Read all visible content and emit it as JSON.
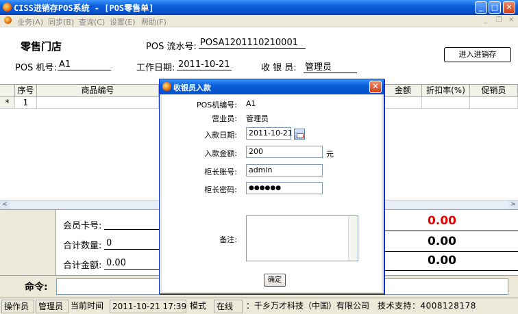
{
  "window": {
    "title": "CISS进销存POS系统 - [POS零售单]",
    "min_label": "_",
    "max_label": "□",
    "close_label": "✕"
  },
  "menu": {
    "items": [
      "业务(A)",
      "同步(B)",
      "查询(C)",
      "设置(E)",
      "帮助(F)"
    ],
    "mdi_controls": [
      "_",
      "❐",
      "✕"
    ]
  },
  "header": {
    "store_name": "零售门店",
    "pos_serial_label": "POS 流水号:",
    "pos_serial_value": "POSA1201110210001",
    "pos_id_label": "POS 机号:",
    "pos_id_value": "A1",
    "work_date_label": "工作日期:",
    "work_date_value": "2011-10-21",
    "cashier_label": "收 银 员:",
    "cashier_value": "管理员",
    "enter_button": "进入进销存"
  },
  "grid": {
    "columns": [
      "序号",
      "商品编号",
      "金额",
      "折扣率(%)",
      "促销员"
    ],
    "row_marker": "*",
    "row_index": "1"
  },
  "scrollbar": {
    "left_arrow": "<",
    "right_arrow": ">"
  },
  "summary": {
    "member_card_label": "会员卡号:",
    "total_qty_label": "合计数量:",
    "total_qty_value": "0",
    "total_amount_label": "合计金额:",
    "total_amount_value": "0.00",
    "right_values": [
      "0.00",
      "0.00",
      "0.00"
    ],
    "right_value_first_color": "#e00000"
  },
  "command": {
    "label": "命令:"
  },
  "status": {
    "operator_label": "操作员",
    "operator_value": "管理员",
    "time_label": "当前时间",
    "time_value": "2011-10-21 17:39",
    "mode_label": "模式",
    "mode_value": "在线",
    "company": "：千乡万才科技（中国）有限公司",
    "support": "技术支持：4008128178"
  },
  "dialog": {
    "title": "收银员入款",
    "close_label": "✕",
    "pos_id_label": "POS机编号:",
    "pos_id_value": "A1",
    "clerk_label": "营业员:",
    "clerk_value": "管理员",
    "date_label": "入款日期:",
    "date_value": "2011-10-21",
    "amount_label": "入款金额:",
    "amount_value": "200",
    "amount_unit": "元",
    "manager_account_label": "柜长账号:",
    "manager_account_value": "admin",
    "manager_password_label": "柜长密码:",
    "manager_password_value": "●●●●●●",
    "memo_label": "备注:",
    "ok_button": "确定"
  },
  "colors": {
    "title_blue": "#0a5fd8",
    "red_value": "#e00000"
  }
}
